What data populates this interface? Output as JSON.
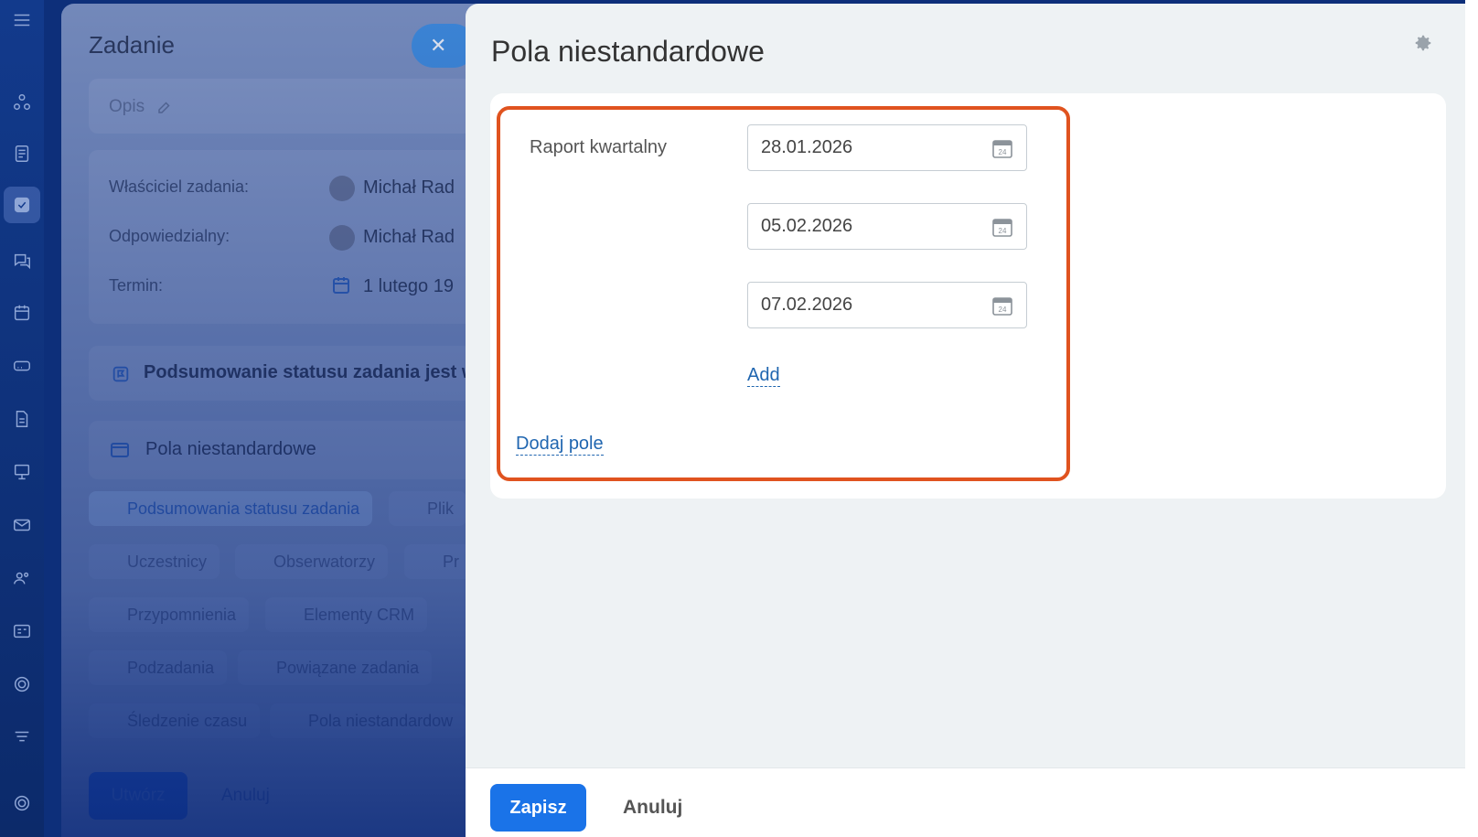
{
  "task": {
    "title": "Zadanie",
    "description_placeholder": "Opis",
    "owner_label": "Właściciel zadania:",
    "owner_value": "Michał Rad",
    "responsible_label": "Odpowiedzialny:",
    "responsible_value": "Michał Rad",
    "deadline_label": "Termin:",
    "deadline_value": "1 lutego 19",
    "summary_text": "Podsumowanie statusu zadania jest w",
    "custom_fields_section": "Pola niestandardowe",
    "chips": [
      "Podsumowania statusu zadania",
      "Plik",
      "Uczestnicy",
      "Obserwatorzy",
      "Pr",
      "Przypomnienia",
      "Elementy CRM",
      "Podzadania",
      "Powiązane zadania",
      "Śledzenie czasu",
      "Pola niestandardow"
    ],
    "create_button": "Utwórz",
    "cancel_button": "Anuluj"
  },
  "slider": {
    "title": "Pola niestandardowe",
    "field_label": "Raport kwartalny",
    "dates": [
      "28.01.2026",
      "05.02.2026",
      "07.02.2026"
    ],
    "calendar_day": "24",
    "add_link": "Add",
    "add_field_link": "Dodaj pole",
    "save_button": "Zapisz",
    "cancel_button": "Anuluj"
  },
  "colors": {
    "highlight": "#e0531f",
    "primary": "#1a73e8",
    "link": "#2066b0"
  }
}
